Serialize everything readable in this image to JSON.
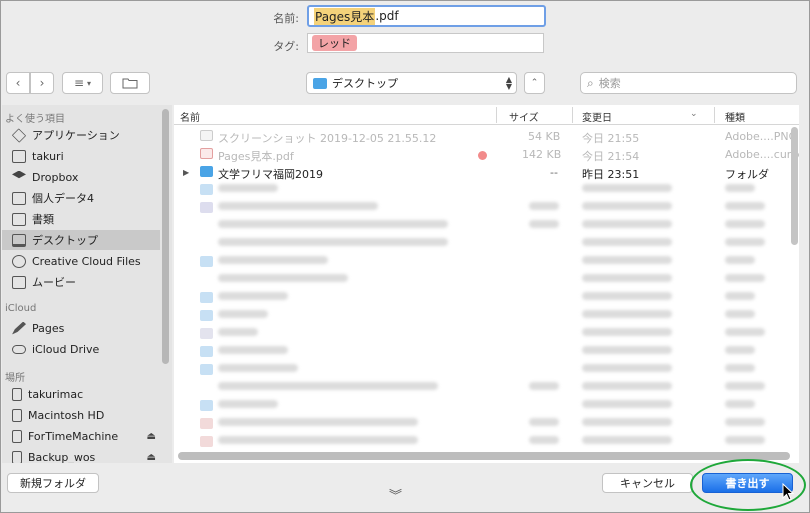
{
  "form": {
    "name_label": "名前:",
    "name_selected": "Pages見本",
    "name_ext": ".pdf",
    "tag_label": "タグ:",
    "tag_value": "レッド",
    "tag_color": "#f3a3a6"
  },
  "toolbar": {
    "back_icon": "chevron-left-icon",
    "forward_icon": "chevron-right-icon",
    "view_icon": "list-view-icon",
    "location": "デスクトップ",
    "search_placeholder": "検索"
  },
  "sidebar": {
    "favorites_header": "よく使う項目",
    "favorites": [
      {
        "label": "アプリケーション",
        "icon": "applications-icon"
      },
      {
        "label": "takuri",
        "icon": "home-icon"
      },
      {
        "label": "Dropbox",
        "icon": "dropbox-icon"
      },
      {
        "label": "個人データ4",
        "icon": "folder-icon"
      },
      {
        "label": "書類",
        "icon": "documents-icon"
      },
      {
        "label": "デスクトップ",
        "icon": "desktop-icon",
        "selected": true
      },
      {
        "label": "Creative Cloud Files",
        "icon": "creative-cloud-icon"
      },
      {
        "label": "ムービー",
        "icon": "movies-icon"
      }
    ],
    "icloud_header": "iCloud",
    "icloud": [
      {
        "label": "Pages",
        "icon": "pages-icon"
      },
      {
        "label": "iCloud Drive",
        "icon": "cloud-icon"
      }
    ],
    "places_header": "場所",
    "places": [
      {
        "label": "takurimac",
        "icon": "computer-icon"
      },
      {
        "label": "Macintosh HD",
        "icon": "disk-icon"
      },
      {
        "label": "ForTimeMachine",
        "icon": "disk-icon",
        "eject": true
      },
      {
        "label": "Backup_wos",
        "icon": "disk-icon",
        "eject": true
      }
    ]
  },
  "columns": {
    "name": "名前",
    "size": "サイズ",
    "modified": "変更日",
    "kind": "種類"
  },
  "files": [
    {
      "name": "スクリーンショット 2019-12-05 21.55.12",
      "size": "54 KB",
      "modified": "今日 21:55",
      "kind": "Adobe....PNG",
      "dim": true
    },
    {
      "name": "Pages見本.pdf",
      "size": "142 KB",
      "modified": "今日 21:54",
      "kind": "Adobe....cument",
      "dim": true,
      "tag_dot": "#f28b8b"
    },
    {
      "name": "文学フリマ福岡2019",
      "size": "--",
      "modified": "昨日 23:51",
      "kind": "フォルダ",
      "folder": true
    }
  ],
  "buttons": {
    "new_folder": "新規フォルダ",
    "cancel": "キャンセル",
    "export": "書き出す"
  },
  "colors": {
    "accent": "#1a6fe8",
    "folder": "#4aa4e6",
    "highlight_ring": "#1fa83a"
  }
}
